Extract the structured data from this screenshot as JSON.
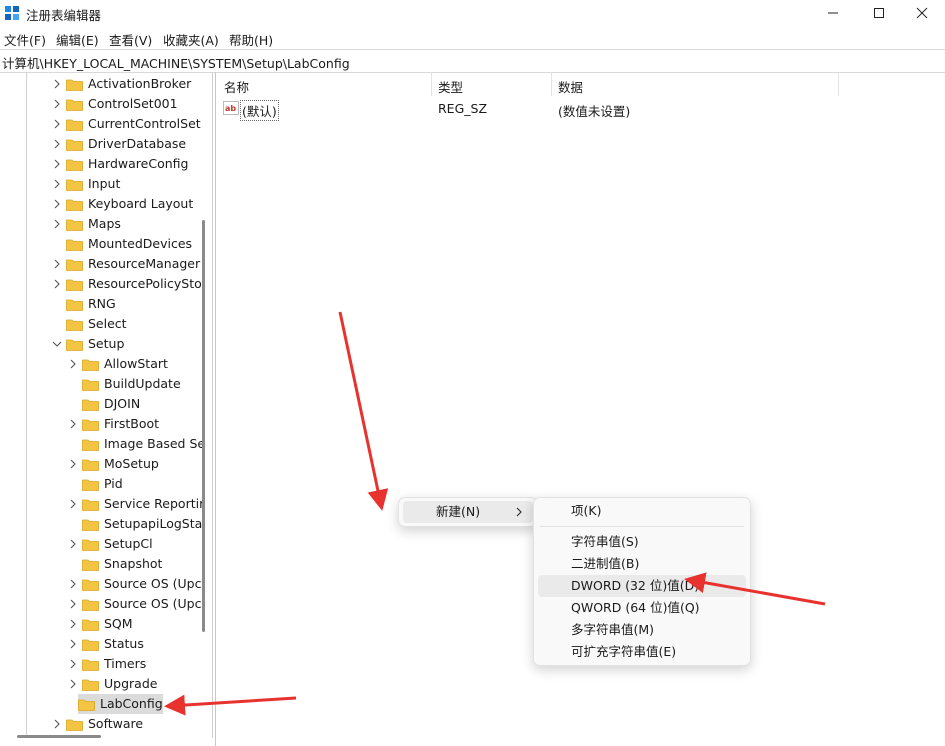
{
  "window": {
    "title": "注册表编辑器"
  },
  "menu": [
    "文件(F)",
    "编辑(E)",
    "查看(V)",
    "收藏夹(A)",
    "帮助(H)"
  ],
  "address": "计算机\\HKEY_LOCAL_MACHINE\\SYSTEM\\Setup\\LabConfig",
  "tree": [
    {
      "label": "ActivationBroker",
      "level": 1,
      "chevron": "right"
    },
    {
      "label": "ControlSet001",
      "level": 1,
      "chevron": "right"
    },
    {
      "label": "CurrentControlSet",
      "level": 1,
      "chevron": "right"
    },
    {
      "label": "DriverDatabase",
      "level": 1,
      "chevron": "right"
    },
    {
      "label": "HardwareConfig",
      "level": 1,
      "chevron": "right"
    },
    {
      "label": "Input",
      "level": 1,
      "chevron": "right"
    },
    {
      "label": "Keyboard Layout",
      "level": 1,
      "chevron": "right"
    },
    {
      "label": "Maps",
      "level": 1,
      "chevron": "right"
    },
    {
      "label": "MountedDevices",
      "level": 1,
      "chevron": "none"
    },
    {
      "label": "ResourceManager",
      "level": 1,
      "chevron": "right"
    },
    {
      "label": "ResourcePolicySto",
      "level": 1,
      "chevron": "right"
    },
    {
      "label": "RNG",
      "level": 1,
      "chevron": "none"
    },
    {
      "label": "Select",
      "level": 1,
      "chevron": "none"
    },
    {
      "label": "Setup",
      "level": 1,
      "chevron": "down"
    },
    {
      "label": "AllowStart",
      "level": 2,
      "chevron": "right"
    },
    {
      "label": "BuildUpdate",
      "level": 2,
      "chevron": "none"
    },
    {
      "label": "DJOIN",
      "level": 2,
      "chevron": "none"
    },
    {
      "label": "FirstBoot",
      "level": 2,
      "chevron": "right"
    },
    {
      "label": "Image Based Se",
      "level": 2,
      "chevron": "none"
    },
    {
      "label": "MoSetup",
      "level": 2,
      "chevron": "right"
    },
    {
      "label": "Pid",
      "level": 2,
      "chevron": "none"
    },
    {
      "label": "Service Reportir",
      "level": 2,
      "chevron": "right"
    },
    {
      "label": "SetupapiLogSta",
      "level": 2,
      "chevron": "none"
    },
    {
      "label": "SetupCl",
      "level": 2,
      "chevron": "right"
    },
    {
      "label": "Snapshot",
      "level": 2,
      "chevron": "none"
    },
    {
      "label": "Source OS (Upc",
      "level": 2,
      "chevron": "right"
    },
    {
      "label": "Source OS (Upc",
      "level": 2,
      "chevron": "right"
    },
    {
      "label": "SQM",
      "level": 2,
      "chevron": "right"
    },
    {
      "label": "Status",
      "level": 2,
      "chevron": "right"
    },
    {
      "label": "Timers",
      "level": 2,
      "chevron": "right"
    },
    {
      "label": "Upgrade",
      "level": 2,
      "chevron": "right"
    },
    {
      "label": "LabConfig",
      "level": 2,
      "chevron": "none",
      "selected": true
    },
    {
      "label": "Software",
      "level": 1,
      "chevron": "right"
    }
  ],
  "columns": {
    "name": "名称",
    "type": "类型",
    "data": "数据"
  },
  "values": [
    {
      "icon": "reg-string-icon",
      "name": "(默认)",
      "type": "REG_SZ",
      "data": "(数值未设置)"
    }
  ],
  "context_menu": {
    "new_label": "新建(N)"
  },
  "submenu": {
    "key": "项(K)",
    "items": [
      "字符串值(S)",
      "二进制值(B)",
      "DWORD (32 位)值(D)",
      "QWORD (64 位)值(Q)",
      "多字符串值(M)",
      "可扩充字符串值(E)"
    ],
    "highlighted_index": 2
  },
  "colors": {
    "annotation_arrow": "#e8322d",
    "folder": "#f4c542",
    "selection": "#dbdbdb"
  }
}
